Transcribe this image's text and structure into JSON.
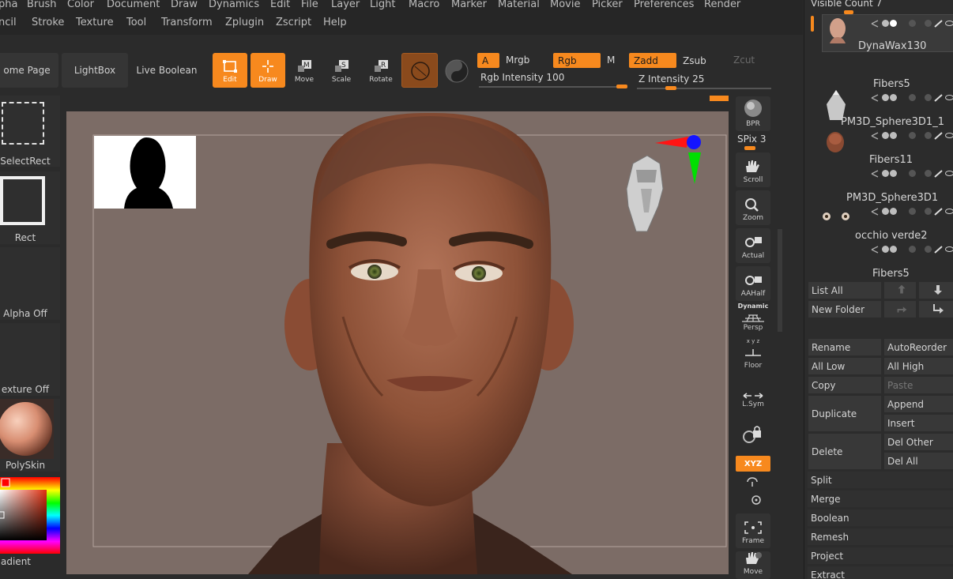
{
  "menu": {
    "row1": [
      "pha",
      "Brush",
      "Color",
      "Document",
      "Draw",
      "Dynamics",
      "Edit",
      "File",
      "Layer",
      "Light",
      "Macro",
      "Marker",
      "Material",
      "Movie",
      "Picker",
      "Preferences",
      "Render"
    ],
    "row2": [
      "ncil",
      "Stroke",
      "Texture",
      "Tool",
      "Transform",
      "Zplugin",
      "Zscript",
      "Help"
    ]
  },
  "toolbar": {
    "home_page": "ome Page",
    "lightbox": "LightBox",
    "live_boolean": "Live Boolean",
    "edit": "Edit",
    "draw": "Draw",
    "move": "Move",
    "scale": "Scale",
    "rotate": "Rotate",
    "a_label": "A",
    "mrgb": "Mrgb",
    "rgb": "Rgb",
    "m": "M",
    "zadd": "Zadd",
    "zsub": "Zsub",
    "zcut": "Zcut",
    "rgb_intensity": "Rgb Intensity 100",
    "z_intensity": "Z Intensity 25",
    "rgb_intensity_value": 100,
    "z_intensity_value": 25
  },
  "left_shelf": {
    "select_rect": "SelectRect",
    "rect": "Rect",
    "alpha": "Alpha Off",
    "texture": "exture Off",
    "material": "PolySkin",
    "gradient": "adient"
  },
  "right_shelf": {
    "bpr": "BPR",
    "spix": "SPix 3",
    "scroll": "Scroll",
    "zoom": "Zoom",
    "actual": "Actual",
    "aahalf": "AAHalf",
    "dynamic": "Dynamic",
    "persp": "Persp",
    "xyz_small": "x y z",
    "floor": "Floor",
    "lsym": "L.Sym",
    "xyz": "XYZ",
    "frame": "Frame",
    "move": "Move"
  },
  "subtool": {
    "visible_count": "Visible Count 7",
    "items": [
      "DynaWax130",
      "Fibers5",
      "PM3D_Sphere3D1_1",
      "Fibers11",
      "PM3D_Sphere3D1",
      "occhio verde2",
      "Fibers5"
    ],
    "buttons": {
      "list_all": "List All",
      "new_folder": "New Folder",
      "rename": "Rename",
      "autoreorder": "AutoReorder",
      "all_low": "All Low",
      "all_high": "All High",
      "copy": "Copy",
      "paste": "Paste",
      "duplicate": "Duplicate",
      "append": "Append",
      "insert": "Insert",
      "delete": "Delete",
      "del_other": "Del Other",
      "del_all": "Del All"
    },
    "sections": [
      "Split",
      "Merge",
      "Boolean",
      "Remesh",
      "Project",
      "Extract"
    ]
  },
  "colors": {
    "accent": "#f7891e",
    "canvas_bg": "#7c6c66",
    "panel_bg": "#2c2c2c"
  }
}
